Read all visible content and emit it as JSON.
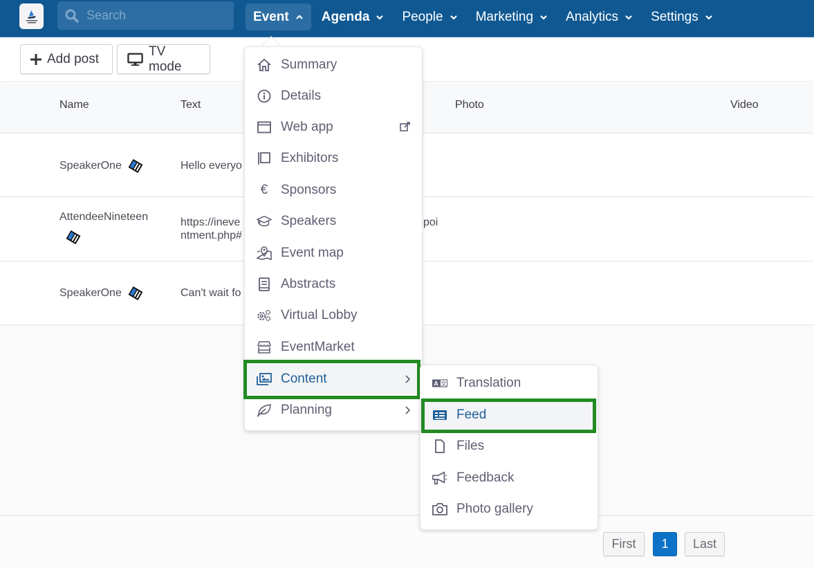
{
  "topbar": {
    "logo_alt": "app-logo",
    "search_placeholder": "Search",
    "nav": [
      {
        "label": "Event",
        "active": true
      },
      {
        "label": "Agenda"
      },
      {
        "label": "People"
      },
      {
        "label": "Marketing"
      },
      {
        "label": "Analytics"
      },
      {
        "label": "Settings"
      }
    ]
  },
  "toolbar": {
    "add_post_label": "Add post",
    "tv_mode_label": "TV mode"
  },
  "table": {
    "columns": [
      "Name",
      "Text",
      "Photo",
      "Video"
    ],
    "rows": [
      {
        "name": "SpeakerOne",
        "text": "Hello everyo"
      },
      {
        "name": "AttendeeNineteen",
        "text_line1": "https://ineve",
        "text_line2": "ntment.php#",
        "text_tail": "poi"
      },
      {
        "name": "SpeakerOne",
        "text": "Can't wait fo"
      }
    ]
  },
  "pagination": {
    "first": "First",
    "current": "1",
    "last": "Last"
  },
  "event_menu": {
    "items": [
      {
        "label": "Summary",
        "icon": "home-icon"
      },
      {
        "label": "Details",
        "icon": "info-icon"
      },
      {
        "label": "Web app",
        "icon": "browser-window-icon",
        "external": true
      },
      {
        "label": "Exhibitors",
        "icon": "booth-icon"
      },
      {
        "label": "Sponsors",
        "icon": "euro-icon"
      },
      {
        "label": "Speakers",
        "icon": "graduation-cap-icon"
      },
      {
        "label": "Event map",
        "icon": "map-pin-icon"
      },
      {
        "label": "Abstracts",
        "icon": "book-icon"
      },
      {
        "label": "Virtual Lobby",
        "icon": "gears-icon"
      },
      {
        "label": "EventMarket",
        "icon": "storefront-icon"
      },
      {
        "label": "Content",
        "icon": "images-icon",
        "submenu": true,
        "highlighted": true
      },
      {
        "label": "Planning",
        "icon": "leaf-icon",
        "submenu": true
      }
    ]
  },
  "content_submenu": {
    "items": [
      {
        "label": "Translation",
        "icon": "translate-icon"
      },
      {
        "label": "Feed",
        "icon": "feed-icon",
        "highlighted": true
      },
      {
        "label": "Files",
        "icon": "file-icon"
      },
      {
        "label": "Feedback",
        "icon": "megaphone-icon"
      },
      {
        "label": "Photo gallery",
        "icon": "camera-icon"
      }
    ]
  },
  "colors": {
    "topbar": "#0f5892",
    "accent": "#0d73c8",
    "highlight_border": "#228b22",
    "menu_text": "#5d5e72",
    "menu_active_text": "#1f5f98"
  }
}
